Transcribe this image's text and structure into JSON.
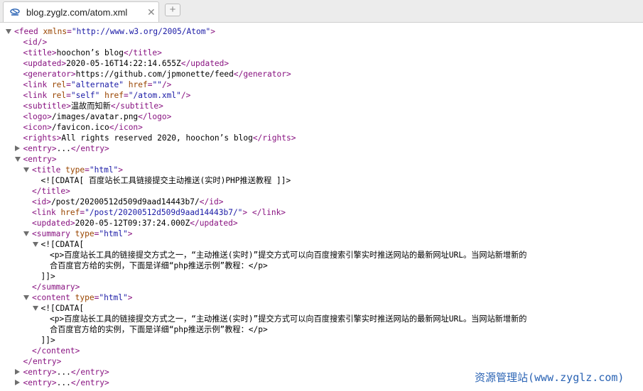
{
  "tab": {
    "title": "blog.zyglz.com/atom.xml",
    "close_glyph": "✕",
    "new_tab_glyph": "+",
    "favicon_icon": "xml-feed-icon"
  },
  "xml": {
    "feed_open": {
      "name": "feed",
      "attrs": [
        {
          "n": "xmlns",
          "v": "http://www.w3.org/2005/Atom"
        }
      ]
    },
    "id": {
      "name": "id"
    },
    "title": {
      "name": "title",
      "text": "hoochon’s blog"
    },
    "updated": {
      "name": "updated",
      "text": "2020-05-16T14:22:14.655Z"
    },
    "generator": {
      "name": "generator",
      "text": "https://github.com/jpmonette/feed"
    },
    "link_alternate": {
      "name": "link",
      "attrs": [
        {
          "n": "rel",
          "v": "alternate"
        },
        {
          "n": "href",
          "v": ""
        }
      ]
    },
    "link_self": {
      "name": "link",
      "attrs": [
        {
          "n": "rel",
          "v": "self"
        },
        {
          "n": "href",
          "v": "/atom.xml"
        }
      ]
    },
    "subtitle": {
      "name": "subtitle",
      "text": "温故而知新"
    },
    "logo": {
      "name": "logo",
      "text": "/images/avatar.png"
    },
    "icon": {
      "name": "icon",
      "text": "/favicon.ico"
    },
    "rights": {
      "name": "rights",
      "text": "All rights reserved 2020, hoochon’s blog"
    },
    "entry_name": "entry",
    "collapsed_ellipsis": "...",
    "entry": {
      "title_open": {
        "name": "title",
        "attrs": [
          {
            "n": "type",
            "v": "html"
          }
        ]
      },
      "title_cdata": "<![CDATA[ 百度站长工具链接提交主动推送(实时)PHP推送教程 ]]>",
      "title_close": "title",
      "id": {
        "name": "id",
        "text": "/post/20200512d509d9aad14443b7/"
      },
      "link": {
        "name": "link",
        "attrs": [
          {
            "n": "href",
            "v": "/post/20200512d509d9aad14443b7/"
          }
        ]
      },
      "updated": {
        "name": "updated",
        "text": "2020-05-12T09:37:24.000Z"
      },
      "summary_open": {
        "name": "summary",
        "attrs": [
          {
            "n": "type",
            "v": "html"
          }
        ]
      },
      "cdata_open": "<![CDATA[",
      "cdata_line1": "<p>百度站长工具的链接提交方式之一，“主动推送(实时)”提交方式可以向百度搜索引擎实时推送网站的最新网址URL。当网站新增新的",
      "cdata_line2": "合百度官方给的实例，下面是详细“php推送示例”教程：</p>",
      "cdata_close": "]]>",
      "summary_close": "summary",
      "content_open": {
        "name": "content",
        "attrs": [
          {
            "n": "type",
            "v": "html"
          }
        ]
      },
      "content_close": "content"
    }
  },
  "watermark": "资源管理站(www.zyglz.com)"
}
